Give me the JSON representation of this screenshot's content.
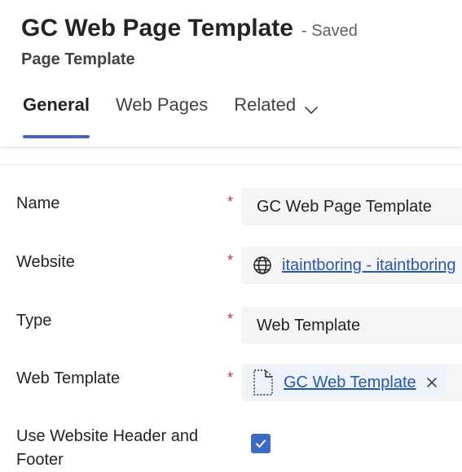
{
  "header": {
    "title": "GC Web Page Template",
    "saved_status": "- Saved",
    "subtitle": "Page Template"
  },
  "tabs": [
    {
      "label": "General",
      "active": true
    },
    {
      "label": "Web Pages",
      "active": false
    },
    {
      "label": "Related",
      "active": false,
      "icon": "chevron-down-icon"
    }
  ],
  "form": {
    "required_marker": "*",
    "name": {
      "label": "Name",
      "value": "GC Web Page Template"
    },
    "website": {
      "label": "Website",
      "value": "itaintboring - itaintboring",
      "icon": "globe-icon"
    },
    "type": {
      "label": "Type",
      "value": "Web Template"
    },
    "web_template": {
      "label": "Web Template",
      "value": "GC Web Template",
      "icon": "document-icon",
      "remove_icon": "close-icon"
    },
    "use_header_footer": {
      "label_line1": "Use Website Header and",
      "label_line2": "Footer",
      "checked": true
    }
  },
  "colors": {
    "accent": "#4766af",
    "link": "#2958a8",
    "required": "#c4314b",
    "checkbox": "#3f6ac4",
    "field_bg": "#f5f5f5"
  }
}
